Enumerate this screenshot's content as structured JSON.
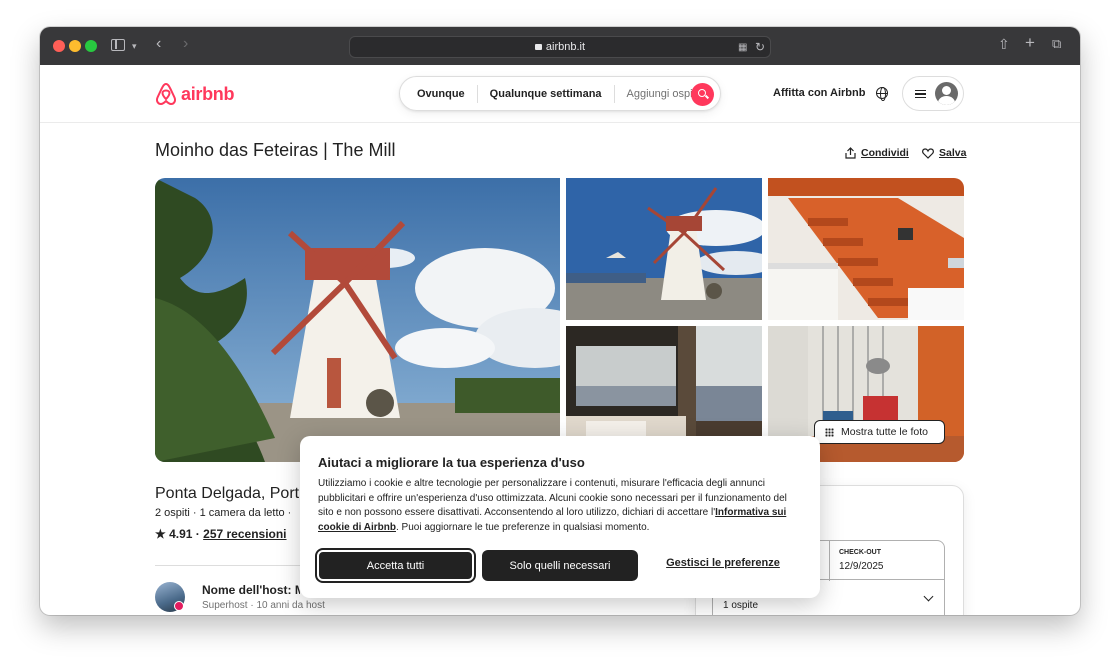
{
  "browser": {
    "url": "airbnb.it"
  },
  "header": {
    "logo_text": "airbnb",
    "brand_color": "#ff385c",
    "search": {
      "where": "Ovunque",
      "when": "Qualunque settimana",
      "guests_placeholder": "Aggiungi ospiti"
    },
    "host_link": "Affitta con Airbnb"
  },
  "listing": {
    "title": "Moinho das Feteiras | The Mill",
    "share_label": "Condividi",
    "save_label": "Salva",
    "show_all_photos": "Mostra tutte le foto",
    "location_title": "Ponta Delgada, Port",
    "details": "2 ospiti · 1 camera da letto ·",
    "rating": "4.91",
    "rating_sep": " · ",
    "reviews": "257 recensioni",
    "host_name": "Nome dell'host: Mc",
    "host_meta": "Superhost · 10 anni da host"
  },
  "booking": {
    "checkout_label": "CHECK-OUT",
    "checkout_value": "12/9/2025",
    "guests_value": "1 ospite"
  },
  "cookie_banner": {
    "title": "Aiutaci a migliorare la tua esperienza d'uso",
    "body": "Utilizziamo i cookie e altre tecnologie per personalizzare i contenuti, misurare l'efficacia degli annunci pubblicitari e offrire un'esperienza d'uso ottimizzata. Alcuni cookie sono necessari per il funzionamento del sito e non possono essere disattivati. Acconsentendo al loro utilizzo, dichiari di accettare l'",
    "policy_link": "Informativa sui cookie di Airbnb",
    "body_end": ". Puoi aggiornare le tue preferenze in qualsiasi momento.",
    "accept_all": "Accetta tutti",
    "only_necessary": "Solo quelli necessari",
    "manage_prefs": "Gestisci le preferenze"
  }
}
